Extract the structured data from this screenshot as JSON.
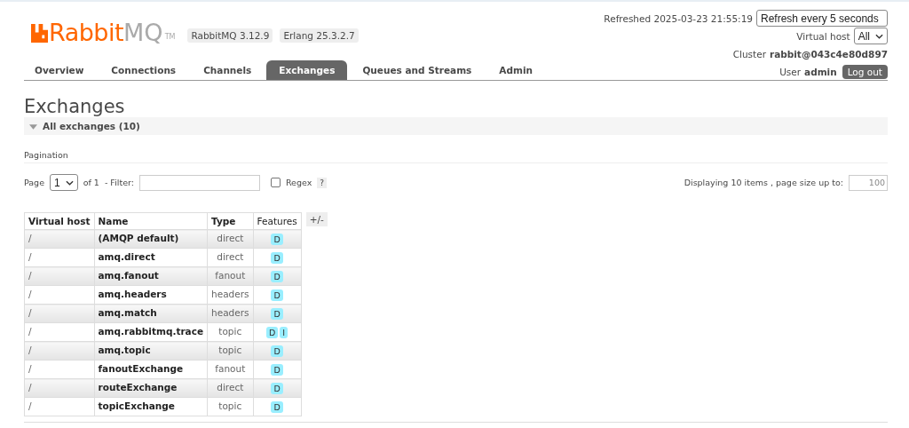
{
  "logo": {
    "brand": "Rabbit",
    "suffix": "MQ",
    "tm": "TM"
  },
  "versions": [
    "RabbitMQ 3.12.9",
    "Erlang 25.3.2.7"
  ],
  "status": {
    "refreshed": "Refreshed 2025-03-23 21:55:19",
    "refresh_select": "Refresh every 5 seconds",
    "vhost_label": "Virtual host",
    "vhost_select": "All",
    "cluster_label": "Cluster",
    "cluster": "rabbit@043c4e80d897",
    "user_label": "User",
    "user": "admin",
    "logout": "Log out"
  },
  "tabs": [
    {
      "label": "Overview",
      "selected": false
    },
    {
      "label": "Connections",
      "selected": false
    },
    {
      "label": "Channels",
      "selected": false
    },
    {
      "label": "Exchanges",
      "selected": true
    },
    {
      "label": "Queues and Streams",
      "selected": false
    },
    {
      "label": "Admin",
      "selected": false
    }
  ],
  "page_title": "Exchanges",
  "section": {
    "title": "All exchanges (10)",
    "expanded": true
  },
  "pagination": {
    "heading": "Pagination",
    "page_label": "Page",
    "page": "1",
    "of": "of 1",
    "filter_label": "- Filter:",
    "regex_label": "Regex",
    "regex_checked": false,
    "help": "?",
    "displaying": "Displaying 10 items , page size up to:",
    "page_size": "100"
  },
  "table": {
    "columns": [
      "Virtual host",
      "Name",
      "Type",
      "Features"
    ],
    "toggle": "+/-",
    "rows": [
      {
        "vhost": "/",
        "name": "(AMQP default)",
        "type": "direct",
        "features": [
          "D"
        ]
      },
      {
        "vhost": "/",
        "name": "amq.direct",
        "type": "direct",
        "features": [
          "D"
        ]
      },
      {
        "vhost": "/",
        "name": "amq.fanout",
        "type": "fanout",
        "features": [
          "D"
        ]
      },
      {
        "vhost": "/",
        "name": "amq.headers",
        "type": "headers",
        "features": [
          "D"
        ]
      },
      {
        "vhost": "/",
        "name": "amq.match",
        "type": "headers",
        "features": [
          "D"
        ]
      },
      {
        "vhost": "/",
        "name": "amq.rabbitmq.trace",
        "type": "topic",
        "features": [
          "D",
          "I"
        ]
      },
      {
        "vhost": "/",
        "name": "amq.topic",
        "type": "topic",
        "features": [
          "D"
        ]
      },
      {
        "vhost": "/",
        "name": "fanoutExchange",
        "type": "fanout",
        "features": [
          "D"
        ]
      },
      {
        "vhost": "/",
        "name": "routeExchange",
        "type": "direct",
        "features": [
          "D"
        ]
      },
      {
        "vhost": "/",
        "name": "topicExchange",
        "type": "topic",
        "features": [
          "D"
        ]
      }
    ]
  }
}
